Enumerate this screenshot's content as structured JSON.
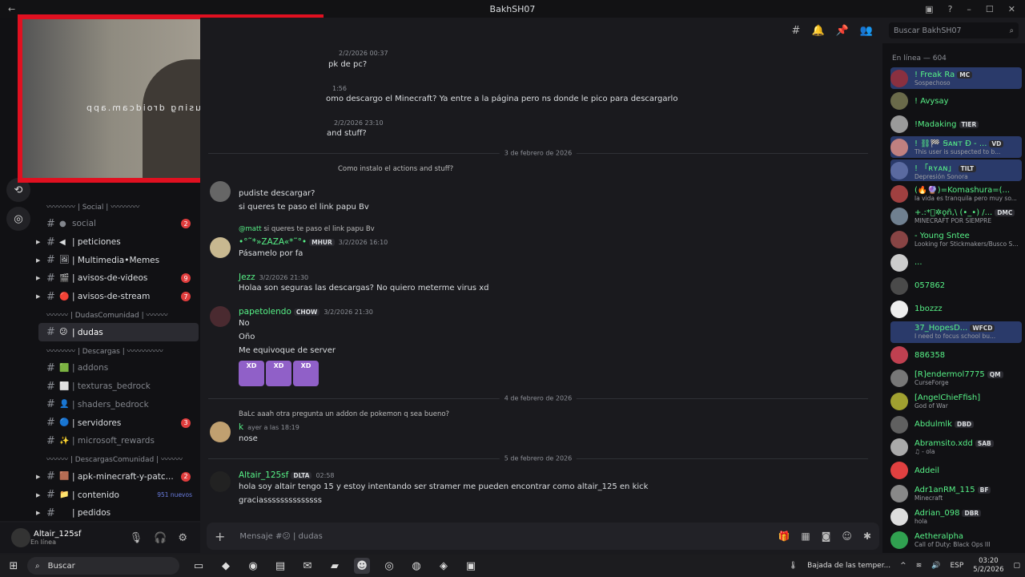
{
  "window": {
    "title": "BakhSH07"
  },
  "search": {
    "placeholder": "Buscar BakhSH07"
  },
  "webcam": {
    "watermark": "using droidcam.app"
  },
  "channels": [
    {
      "type": "cat",
      "label": "〰〰〰〰 | Social | 〰〰〰〰"
    },
    {
      "type": "ch",
      "emoji": "●",
      "label": "social",
      "muted": true,
      "badge": "2"
    },
    {
      "type": "ch",
      "emoji": "◀",
      "label": "| peticiones",
      "arrow": true
    },
    {
      "type": "ch",
      "emoji": "🖼",
      "label": "| Multimedia•Memes",
      "arrow": true
    },
    {
      "type": "ch",
      "emoji": "🎬",
      "label": "| avisos-de-videos",
      "arrow": true,
      "badge": "9"
    },
    {
      "type": "ch",
      "emoji": "🔴",
      "label": "| avisos-de-stream",
      "arrow": true,
      "badge": "7"
    },
    {
      "type": "cat",
      "label": "〰〰〰 | DudasComunidad | 〰〰〰"
    },
    {
      "type": "ch",
      "emoji": "😕",
      "label": "| dudas",
      "active": true
    },
    {
      "type": "cat",
      "label": "〰〰〰〰 | Descargas | 〰〰〰〰〰"
    },
    {
      "type": "ch",
      "emoji": "🟩",
      "label": "| addons",
      "muted": true
    },
    {
      "type": "ch",
      "emoji": "⬜",
      "label": "| texturas_bedrock",
      "muted": true
    },
    {
      "type": "ch",
      "emoji": "👤",
      "label": "| shaders_bedrock",
      "muted": true
    },
    {
      "type": "ch",
      "emoji": "🔵",
      "label": "| servidores",
      "badge": "3"
    },
    {
      "type": "ch",
      "emoji": "✨",
      "label": "| microsoft_rewards",
      "muted": true
    },
    {
      "type": "cat",
      "label": "〰〰〰 | DescargasComunidad | 〰〰〰"
    },
    {
      "type": "ch",
      "emoji": "🟫",
      "label": "| apk-minecraft-y-patc...",
      "arrow": true,
      "badge": "2"
    },
    {
      "type": "ch",
      "emoji": "📁",
      "label": "| contenido",
      "arrow": true,
      "newtag": "951 nuevos"
    },
    {
      "type": "ch",
      "emoji": "",
      "label": "| pedidos",
      "arrow": true
    }
  ],
  "user": {
    "name": "Altair_125sf",
    "status": "En línea"
  },
  "composer": {
    "placeholder": "Mensaje #😕 | dudas"
  },
  "messages": {
    "m1": {
      "ts": "2/2/2026 00:37",
      "text": "pk de pc?"
    },
    "m2": {
      "ts": "1:56",
      "text": "omo descargo el Minecraft? Ya entre a la página pero ns donde le pico para descargarlo"
    },
    "m3": {
      "ts": "2/2/2026 23:10",
      "text": "and stuff?"
    },
    "div1": "3 de febrero de 2026",
    "m4_reply": "Como instalo el actions and stuff?",
    "m4_l1": "pudiste descargar?",
    "m4_l2": "si queres te paso el link papu Bv",
    "m5_reply_user": "@matt",
    "m5_reply_text": "si queres te paso el link papu Bv",
    "m5_user": "•°˜*»ZAZA«*˜°•",
    "m5_tag": "MHUR",
    "m5_ts": "3/2/2026 16:10",
    "m5_text": "Pásamelo por fa",
    "m6_user": "Jezz",
    "m6_ts": "3/2/2026 21:30",
    "m6_text": "Holaa son seguras las descargas? No quiero meterme virus xd",
    "m7_user": "papetolendo",
    "m7_tag": "CHOW",
    "m7_ts": "3/2/2026 21:30",
    "m7_l1": "No",
    "m7_l2": "Oño",
    "m7_l3": "Me equivoque de server",
    "sticker": "XD",
    "div2": "4 de febrero de 2026",
    "m8_reply_user": "BaLc",
    "m8_reply_text": "aaah otra pregunta un addon de pokemon q sea bueno?",
    "m8_user": "k",
    "m8_ts": "ayer a las 18:19",
    "m8_text": "nose",
    "div3": "5 de febrero de 2026",
    "m9_user": "Altair_125sf",
    "m9_tag": "DLTA",
    "m9_ts": "02:58",
    "m9_l1": "hola soy altair tengo 15 y estoy intentando ser stramer me pueden encontrar como altair_125 en kick",
    "m9_l2": "graciassssssssssssss"
  },
  "members": {
    "header": "En línea — 604",
    "list": [
      {
        "name": "! Freak Ra",
        "tag": "MC",
        "sub": "Sospechoso",
        "hl": true
      },
      {
        "name": "! Avysay",
        "sub": ""
      },
      {
        "name": "!Madaking",
        "tag": "TIER",
        "sub": ""
      },
      {
        "name": "! ⛓🏁 Ꞩᴀɴᴛ Ð - ...",
        "tag": "VD",
        "sub": "This user is suspected to b...",
        "hl": true
      },
      {
        "name": "! 「ʀʏᴀɴ」",
        "tag": "TILT",
        "sub": "Depresión Sonora",
        "hl": true
      },
      {
        "name": "(🔥🔮)=Komashura=(...",
        "sub": "la vida es tranquila pero muy so..."
      },
      {
        "name": "+.:*ﾟ✲ǫñ,\\ (•_•) /...",
        "tag": "DMC",
        "sub": "MINECRAFT POR SIEMPRE"
      },
      {
        "name": "- Young Sntee",
        "sub": "Looking for Stickmakers/Busco Sti..."
      },
      {
        "name": "...",
        "sub": ""
      },
      {
        "name": "057862",
        "sub": ""
      },
      {
        "name": "1bozzz",
        "sub": ""
      },
      {
        "name": "37_HopesD...",
        "tag": "WFCD",
        "sub": "I need to focus school bu...",
        "hl": true
      },
      {
        "name": "886358",
        "sub": ""
      },
      {
        "name": "[R]endermol7775",
        "tag": "QM",
        "sub": "CurseForge"
      },
      {
        "name": "[AngelChieFfish]",
        "sub": "God of War"
      },
      {
        "name": "Abdulmlk",
        "tag": "DBD",
        "sub": ""
      },
      {
        "name": "Abramsito.xdd",
        "tag": "SAB",
        "sub": "♫ - ola"
      },
      {
        "name": "Addeil",
        "sub": ""
      },
      {
        "name": "Adr1anRM_115",
        "tag": "BF",
        "sub": "Minecraft"
      },
      {
        "name": "Adrian_098",
        "tag": "DBR",
        "sub": "hola"
      },
      {
        "name": "Aetheralpha",
        "sub": "Call of Duty: Black Ops III"
      }
    ]
  },
  "taskbar": {
    "search": "Buscar",
    "weather": "Bajada de las temper...",
    "lang": "ESP",
    "time": "03:20",
    "date": "5/2/2026"
  }
}
